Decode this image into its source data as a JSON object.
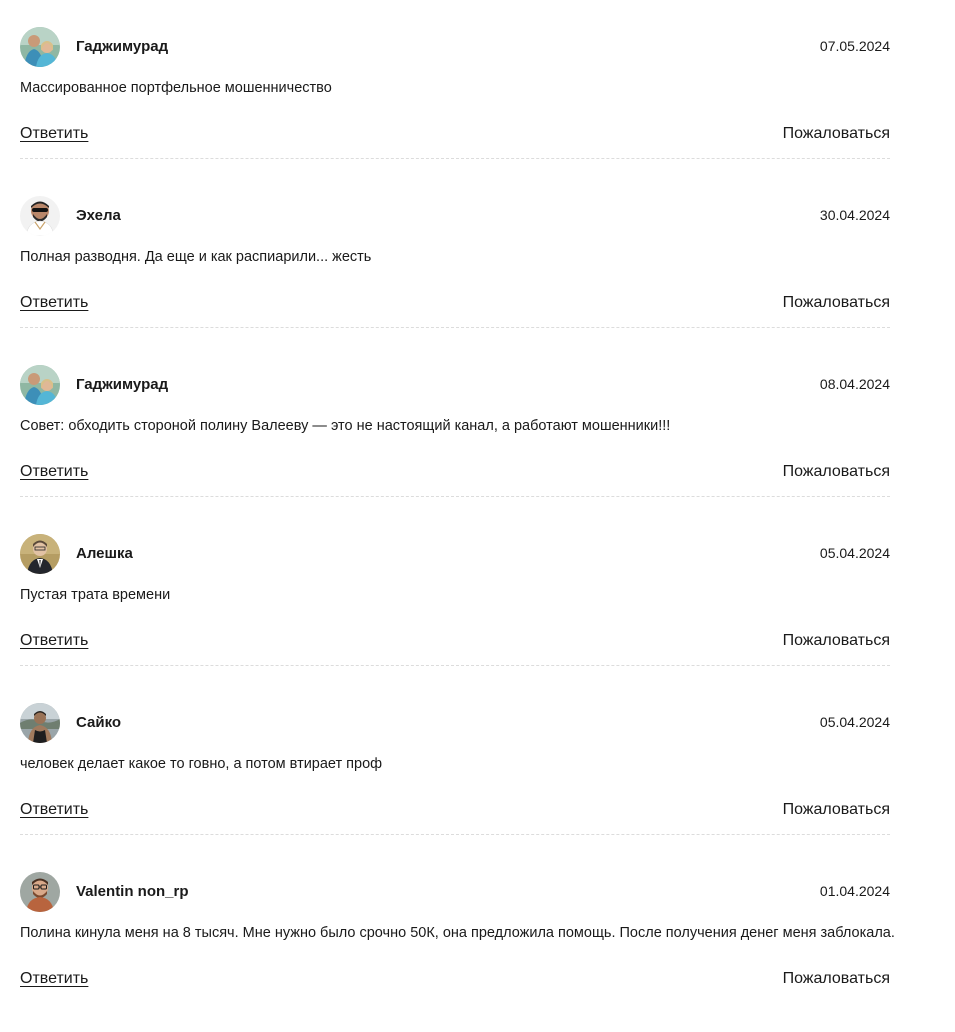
{
  "comments": [
    {
      "author": "Гаджимурад",
      "date": "07.05.2024",
      "text": "Массированное портфельное мошенничество",
      "reply_label": "Ответить",
      "report_label": "Пожаловаться",
      "avatar_icon": "avatar-couple-photo"
    },
    {
      "author": "Эхела",
      "date": "30.04.2024",
      "text": "Полная разводня. Да еще и как распиарили... жесть",
      "reply_label": "Ответить",
      "report_label": "Пожаловаться",
      "avatar_icon": "avatar-man-sunglasses-photo"
    },
    {
      "author": "Гаджимурад",
      "date": "08.04.2024",
      "text": "Совет: обходить стороной полину Валееву — это не настоящий канал, а работают мошенники!!!",
      "reply_label": "Ответить",
      "report_label": "Пожаловаться",
      "avatar_icon": "avatar-couple-photo"
    },
    {
      "author": "Алешка",
      "date": "05.04.2024",
      "text": "Пустая трата времени",
      "reply_label": "Ответить",
      "report_label": "Пожаловаться",
      "avatar_icon": "avatar-man-suit-photo"
    },
    {
      "author": "Сайко",
      "date": "05.04.2024",
      "text": "человек делает какое то говно, а потом втирает проф",
      "reply_label": "Ответить",
      "report_label": "Пожаловаться",
      "avatar_icon": "avatar-man-outdoor-photo"
    },
    {
      "author": "Valentin non_rp",
      "date": "01.04.2024",
      "text": "Полина кинула меня на 8 тысяч. Мне нужно было срочно 50К, она предложила помощь. После получения денег меня заблокала.",
      "reply_label": "Ответить",
      "report_label": "Пожаловаться",
      "avatar_icon": "avatar-man-glasses-photo"
    }
  ],
  "colors": {
    "text": "#1a1a1a",
    "divider": "#dcdcdc",
    "background": "#ffffff"
  }
}
